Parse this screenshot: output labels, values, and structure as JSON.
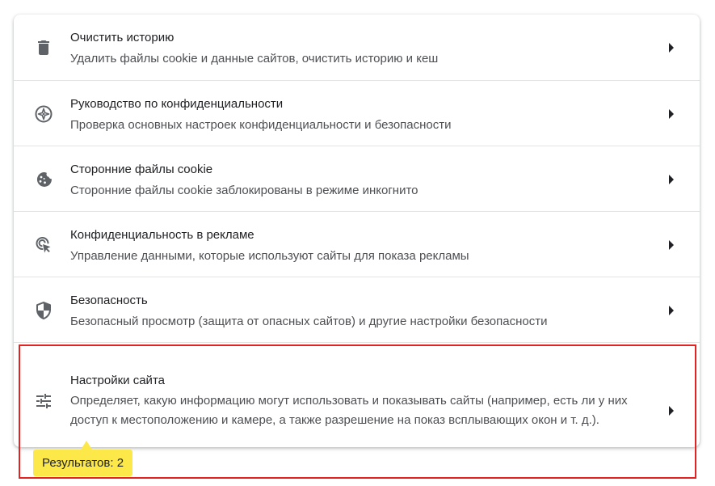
{
  "settings": {
    "items": [
      {
        "title": "Очистить историю",
        "description": "Удалить файлы cookie и данные сайтов, очистить историю и кеш",
        "icon": "trash-icon"
      },
      {
        "title": "Руководство по конфиденциальности",
        "description": "Проверка основных настроек конфиденциальности и безопасности",
        "icon": "compass-icon"
      },
      {
        "title": "Сторонние файлы cookie",
        "description": "Сторонние файлы cookie заблокированы в режиме инкогнито",
        "icon": "cookie-icon"
      },
      {
        "title": "Конфиденциальность в рекламе",
        "description": "Управление данными, которые используют сайты для показа рекламы",
        "icon": "ad-privacy-icon"
      },
      {
        "title": "Безопасность",
        "description": "Безопасный просмотр (защита от опасных сайтов) и другие настройки безопасности",
        "icon": "shield-icon"
      },
      {
        "title": "Настройки сайта",
        "description": "Определяет, какую информацию могут использовать и показывать сайты (например, есть ли у них доступ к местоположению и камере, а также разрешение на показ всплывающих окон и т. д.).",
        "icon": "tune-icon"
      }
    ]
  },
  "search_results": {
    "label": "Результатов: 2"
  },
  "colors": {
    "highlight_border": "#e32222",
    "badge_background": "#fde84a",
    "icon_color": "#5f6368"
  }
}
